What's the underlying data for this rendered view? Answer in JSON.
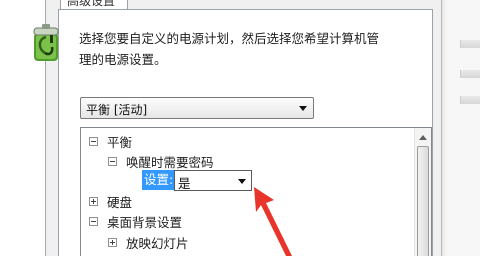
{
  "dialog": {
    "tab_label": "高级设置",
    "description": "选择您要自定义的电源计划，然后选择您希望计算机管理的电源设置。",
    "plan_select": {
      "value": "平衡 [活动]"
    }
  },
  "tree": {
    "items": [
      {
        "label": "平衡",
        "expanded": true
      },
      {
        "label": "唤醒时需要密码",
        "expanded": true
      },
      {
        "label": "硬盘",
        "expanded": false
      },
      {
        "label": "桌面背景设置",
        "expanded": true
      },
      {
        "label": "放映幻灯片",
        "expanded": false
      }
    ],
    "setting": {
      "label": "设置:",
      "value": "是"
    }
  },
  "icons": {
    "power_plan": "battery-power-icon",
    "annotation": "red-arrow-annotation"
  },
  "colors": {
    "selection": "#3399ff",
    "annotation": "#e8342a"
  }
}
